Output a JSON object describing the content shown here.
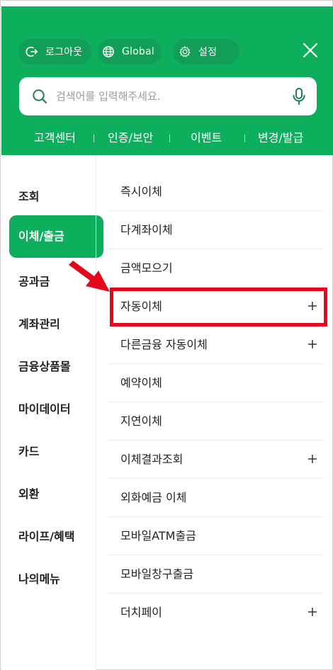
{
  "header": {
    "logout_label": "로그아웃",
    "global_label": "Global",
    "settings_label": "설정",
    "search_placeholder": "검색어를 입력해주세요.",
    "quick_links": [
      "고객센터",
      "인증/보안",
      "이벤트",
      "변경/발급"
    ]
  },
  "left_nav": {
    "items": [
      "조회",
      "이체/출금",
      "공과금",
      "계좌관리",
      "금융상품몰",
      "마이데이터",
      "카드",
      "외환",
      "라이프/혜택",
      "나의메뉴"
    ],
    "active_index": 1
  },
  "right_list": {
    "items": [
      {
        "label": "즉시이체",
        "expandable": false
      },
      {
        "label": "다계좌이체",
        "expandable": false
      },
      {
        "label": "금액모으기",
        "expandable": false
      },
      {
        "label": "자동이체",
        "expandable": true
      },
      {
        "label": "다른금융 자동이체",
        "expandable": true
      },
      {
        "label": "예약이체",
        "expandable": false
      },
      {
        "label": "지연이체",
        "expandable": false
      },
      {
        "label": "이체결과조회",
        "expandable": true
      },
      {
        "label": "외화예금 이체",
        "expandable": false
      },
      {
        "label": "모바일ATM출금",
        "expandable": false
      },
      {
        "label": "모바일창구출금",
        "expandable": false
      },
      {
        "label": "더치페이",
        "expandable": true
      }
    ],
    "highlighted_index": 3
  },
  "colors": {
    "brand_green": "#0daf5c",
    "chip_green": "#119e56",
    "annotation_red": "#e4071b"
  },
  "icons": [
    "logout-icon",
    "globe-icon",
    "gear-icon",
    "close-icon",
    "search-icon",
    "microphone-icon",
    "plus-icon",
    "arrow-annotation"
  ]
}
